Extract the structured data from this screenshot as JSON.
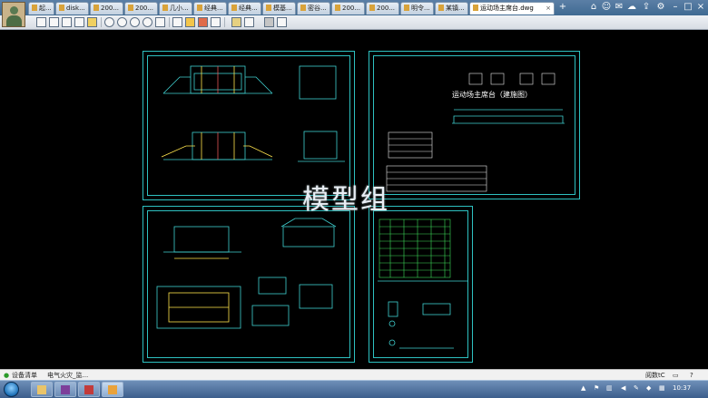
{
  "tabs": [
    {
      "label": "起...",
      "active": false
    },
    {
      "label": "disk...",
      "active": false
    },
    {
      "label": "200...",
      "active": false
    },
    {
      "label": "200...",
      "active": false
    },
    {
      "label": "几小...",
      "active": false
    },
    {
      "label": "经典...",
      "active": false
    },
    {
      "label": "经典...",
      "active": false
    },
    {
      "label": "模基...",
      "active": false
    },
    {
      "label": "密谷...",
      "active": false
    },
    {
      "label": "200...",
      "active": false
    },
    {
      "label": "200...",
      "active": false
    },
    {
      "label": "明令...",
      "active": false
    },
    {
      "label": "某镇...",
      "active": false
    },
    {
      "label": "运动场主席台.dwg",
      "active": true
    }
  ],
  "drawing": {
    "title": "运动场主席台（建施图）",
    "watermark": "模型组"
  },
  "statusbar": {
    "item1": "设备清单",
    "item2": "电气火灾_监...",
    "right_label": "阅数tC"
  },
  "taskbar": {
    "clock": "10:37"
  },
  "colors": {
    "sheet_border": "#2ec1c1",
    "drawing_lines": "#3fd0d0",
    "accent_lines": "#ffe44d",
    "green_lines": "#3fdc5a",
    "taskbar": "#3c5e8c"
  }
}
